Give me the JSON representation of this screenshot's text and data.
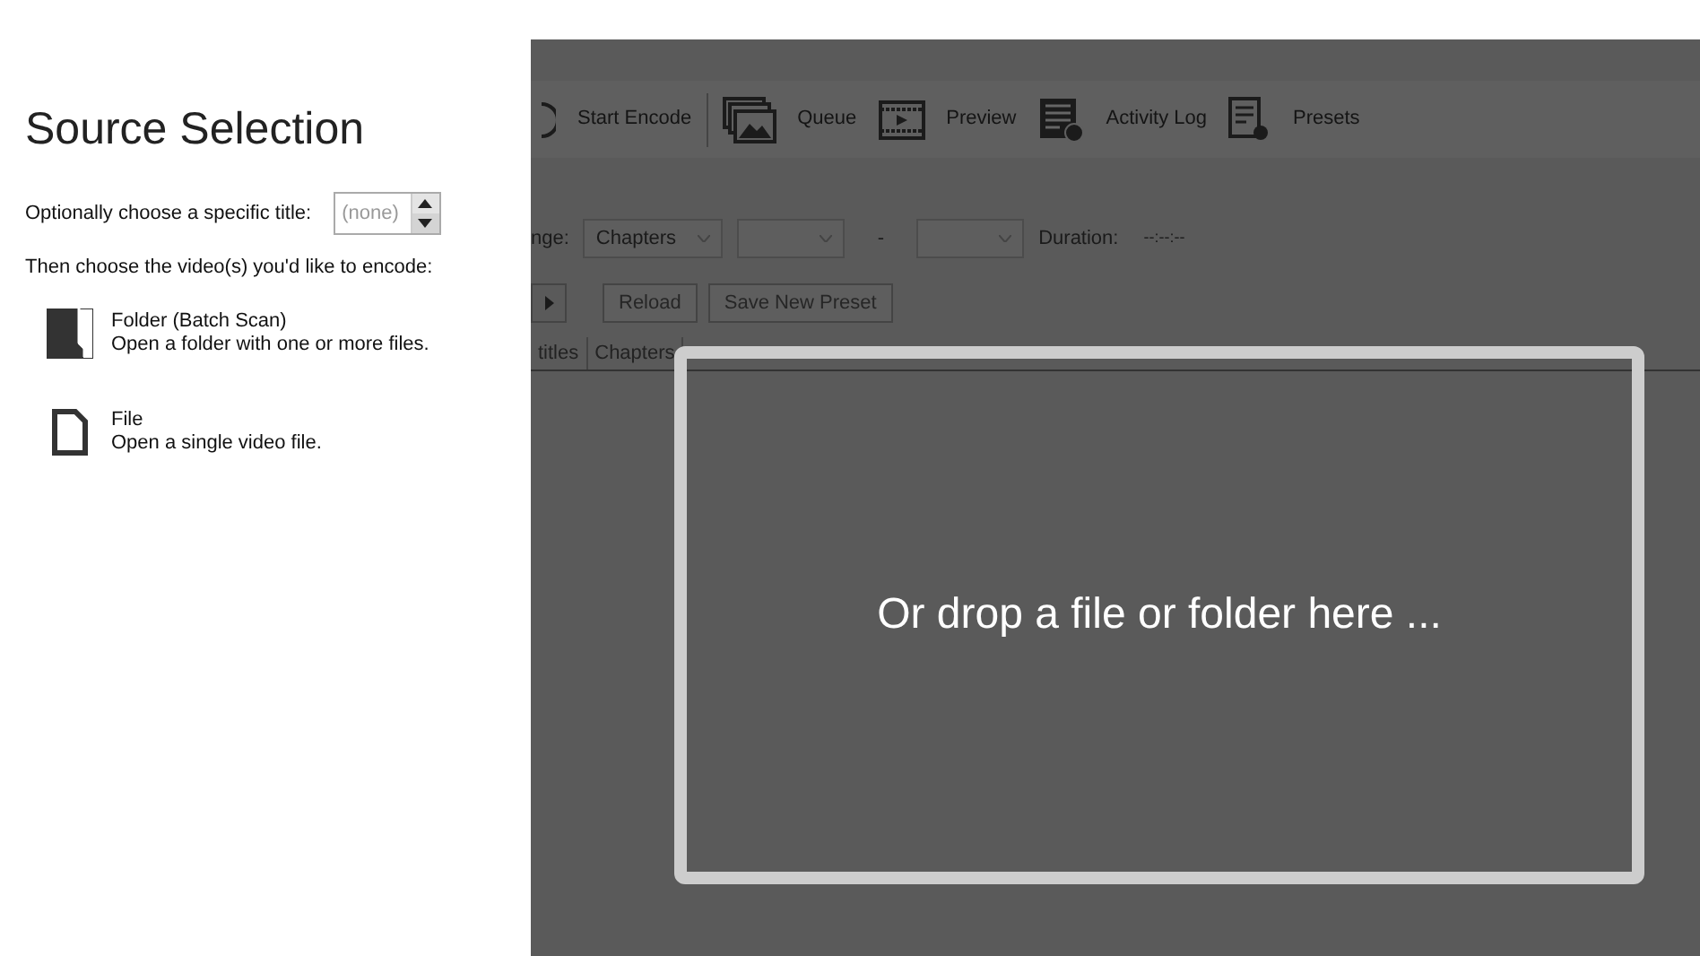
{
  "source_panel": {
    "title": "Source Selection",
    "title_picker": {
      "label": "Optionally choose a specific title:",
      "placeholder": "(none)"
    },
    "instruction": "Then choose the video(s) you'd like to encode:",
    "options": [
      {
        "kind": "folder",
        "name": "Folder (Batch Scan)",
        "description": "Open a folder with one or more files."
      },
      {
        "kind": "file",
        "name": "File",
        "description": "Open a single video file."
      }
    ]
  },
  "toolbar": [
    {
      "kind": "start",
      "label": "Start Encode"
    },
    {
      "kind": "queue",
      "label": "Queue"
    },
    {
      "kind": "preview",
      "label": "Preview"
    },
    {
      "kind": "log",
      "label": "Activity Log"
    },
    {
      "kind": "presets",
      "label": "Presets"
    }
  ],
  "range": {
    "label": "nge:",
    "mode": "Chapters",
    "separator": "-",
    "duration_label": "Duration:",
    "duration": "--:--:--"
  },
  "buttons": [
    "Reload",
    "Save New Preset"
  ],
  "tabs": [
    "titles",
    "Chapters"
  ],
  "drop_zone": {
    "text": "Or drop a file or folder here ..."
  }
}
